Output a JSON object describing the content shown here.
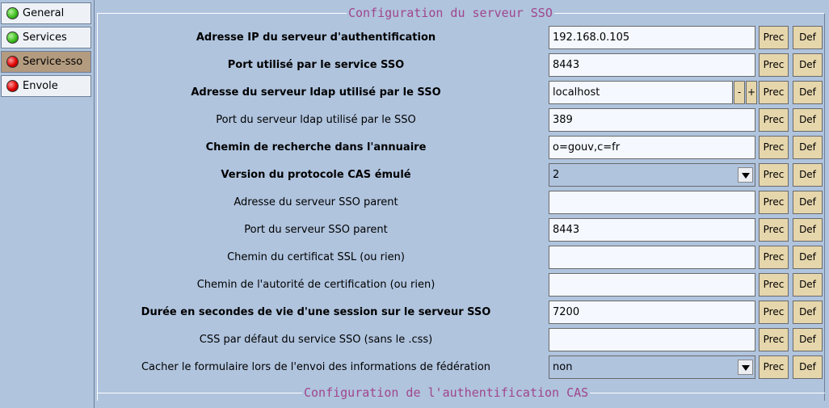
{
  "sidebar": {
    "tabs": [
      {
        "label": "General",
        "status": "green"
      },
      {
        "label": "Services",
        "status": "green"
      },
      {
        "label": "Service-sso",
        "status": "red"
      },
      {
        "label": "Envole",
        "status": "red"
      }
    ],
    "active": "Service-sso"
  },
  "main": {
    "section_title": "Configuration du serveur SSO",
    "next_section_title": "Configuration de l'authentification CAS",
    "buttons": {
      "prec": "Prec",
      "def": "Def",
      "minus": "-",
      "plus": "+"
    },
    "fields": [
      {
        "label": "Adresse IP du serveur d'authentification",
        "value": "192.168.0.105",
        "bold": true
      },
      {
        "label": "Port utilisé par le service SSO",
        "value": "8443",
        "bold": true
      },
      {
        "label": "Adresse du serveur ldap utilisé par le SSO",
        "value": "localhost",
        "bold": true
      },
      {
        "label": "Port du serveur ldap utilisé par le SSO",
        "value": "389",
        "bold": false
      },
      {
        "label": "Chemin de recherche dans l'annuaire",
        "value": "o=gouv,c=fr",
        "bold": true
      },
      {
        "label": "Version du protocole CAS émulé",
        "value": "2",
        "bold": true
      },
      {
        "label": "Adresse du serveur SSO parent",
        "value": "",
        "bold": false
      },
      {
        "label": "Port du serveur SSO parent",
        "value": "8443",
        "bold": false
      },
      {
        "label": "Chemin du certificat SSL (ou rien)",
        "value": "",
        "bold": false
      },
      {
        "label": "Chemin de l'autorité de certification (ou rien)",
        "value": "",
        "bold": false
      },
      {
        "label": "Durée en secondes de vie d'une session sur le serveur SSO",
        "value": "7200",
        "bold": true
      },
      {
        "label": "CSS par défaut du service SSO (sans le .css)",
        "value": "",
        "bold": false
      },
      {
        "label": "Cacher le formulaire lors de l'envoi des informations de fédération",
        "value": "non",
        "bold": false
      }
    ]
  },
  "colors": {
    "background": "#b0c4de",
    "section_title": "#a0468c",
    "button": "#e6d6ac",
    "active_tab": "#b39b7f",
    "status_green": "#3fbf1f",
    "status_red": "#e00000"
  }
}
